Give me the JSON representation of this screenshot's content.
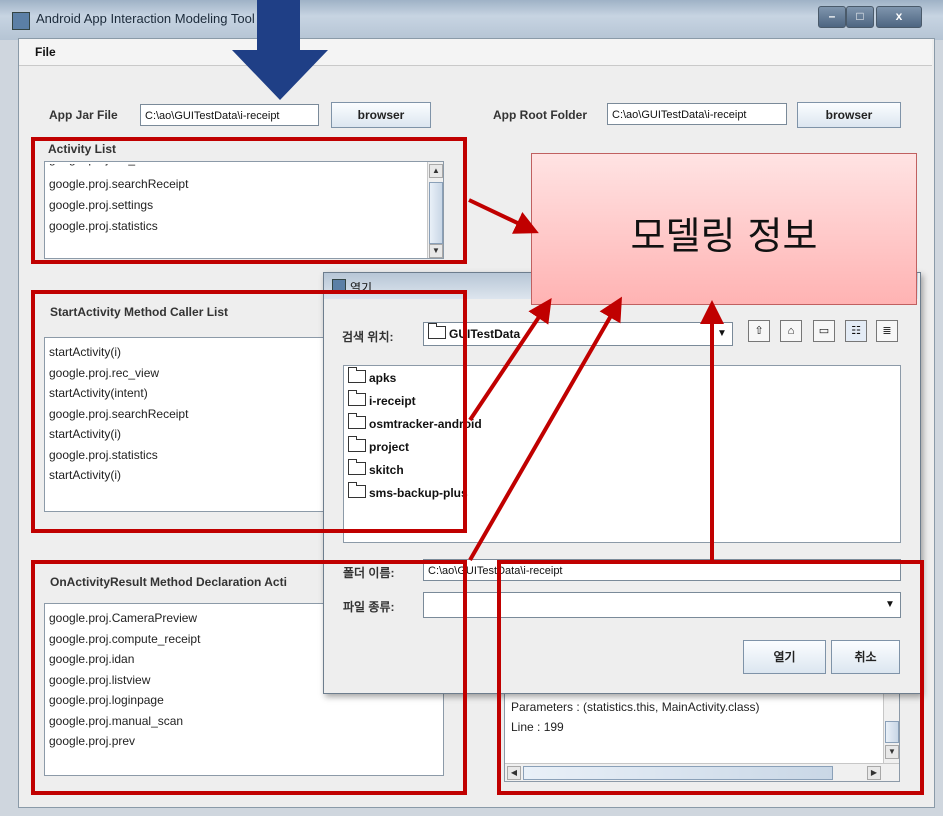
{
  "window": {
    "title": "Android App Interaction Modeling Tool"
  },
  "menu": {
    "file": "File"
  },
  "top": {
    "app_jar_label": "App Jar File",
    "app_jar_value": "C:\\ao\\GUITestData\\i-receipt",
    "browser_label": "browser",
    "root_folder_label": "App Root Folder",
    "root_folder_value": "C:\\ao\\GUITestData\\i-receipt",
    "browser2_label": "browser"
  },
  "activity_list": {
    "title": "Activity List",
    "items": [
      "google.proj.searchReceipt",
      "google.proj.settings",
      "google.proj.statistics"
    ]
  },
  "caller_list": {
    "title": "StartActivity Method Caller List",
    "items": [
      "startActivity(i)",
      "google.proj.rec_view",
      "startActivity(intent)",
      "google.proj.searchReceipt",
      "startActivity(i)",
      "google.proj.statistics",
      "startActivity(i)"
    ]
  },
  "onresult_list": {
    "title": "OnActivityResult Method Declaration Acti",
    "items": [
      "google.proj.CameraPreview",
      "google.proj.compute_receipt",
      "google.proj.idan",
      "google.proj.listview",
      "google.proj.loginpage",
      "google.proj.manual_scan",
      "google.proj.prev"
    ]
  },
  "detail": {
    "lines": [
      "Parameters : (statistics.this, MainActivity.class)",
      "Line : 199"
    ]
  },
  "dialog": {
    "title": "열기",
    "look_in_label": "검색 위치:",
    "look_in_value": "GUITestData",
    "folders": [
      "apks",
      "i-receipt",
      "osmtracker-android",
      "project",
      "skitch",
      "sms-backup-plus"
    ],
    "folder_name_label": "폴더 이름:",
    "folder_name_value": "C:\\ao\\GUITestData\\i-receipt",
    "file_type_label": "파일 종류:",
    "open_button": "열기",
    "cancel_button": "취소"
  },
  "callout": {
    "text": "모델링 정보"
  },
  "colors": {
    "annotation_red": "#c00000",
    "callout_fill": "#ffc4c4",
    "arrow_blue": "#1f3f86"
  },
  "icons": [
    "app-icon",
    "minimize-icon",
    "maximize-icon",
    "close-icon",
    "folder-icon",
    "up-folder-icon",
    "home-icon",
    "new-folder-icon",
    "list-view-icon",
    "details-view-icon",
    "dropdown-arrow-icon"
  ]
}
